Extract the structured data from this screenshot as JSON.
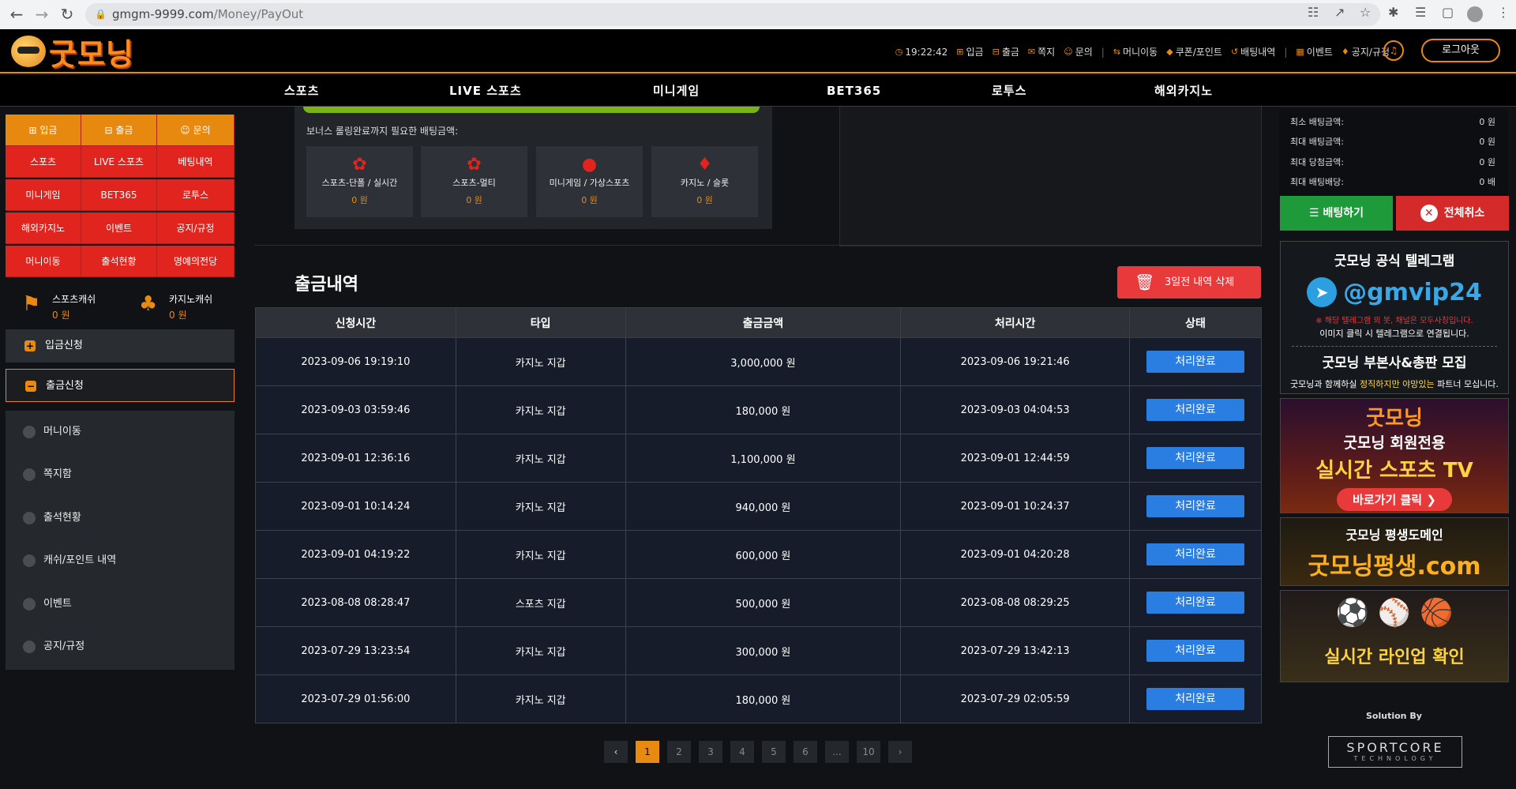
{
  "browser": {
    "url_host": "gmgm-9999.com",
    "url_path": "/Money/PayOut"
  },
  "header": {
    "logo_text": "굿모닝",
    "time": "19:22:42",
    "menu": [
      "입금",
      "출금",
      "쪽지",
      "문의",
      "머니이동",
      "쿠폰/포인트",
      "배팅내역",
      "이벤트",
      "공지/규정"
    ],
    "logout_label": "로그아웃"
  },
  "mainnav": [
    "스포츠",
    "LIVE 스포츠",
    "미니게임",
    "BET365",
    "로투스",
    "해외카지노"
  ],
  "sidebar": {
    "quick_top": [
      "입금",
      "출금",
      "문의"
    ],
    "quick_grid": [
      "스포츠",
      "LIVE 스포츠",
      "베팅내역",
      "미니게임",
      "BET365",
      "로투스",
      "해외카지노",
      "이벤트",
      "공지/규정",
      "머니이동",
      "출석현황",
      "명예의전당"
    ],
    "sports_cash_label": "스포츠캐쉬",
    "sports_cash_value": "0 원",
    "casino_cash_label": "카지노캐쉬",
    "casino_cash_value": "0 원",
    "deposit_request": "입금신청",
    "withdraw_request": "출금신청",
    "sub_items": [
      "머니이동",
      "쪽지함",
      "출석현황",
      "캐쉬/포인트 내역",
      "이벤트",
      "공지/규정"
    ]
  },
  "bonus": {
    "title": "보너스 롤링완료까지 필요한 배팅금액:",
    "cards": [
      {
        "label": "스포츠-단폴 / 실시간",
        "value": "0 원"
      },
      {
        "label": "스포츠-멀티",
        "value": "0 원"
      },
      {
        "label": "미니게임 / 가상스포츠",
        "value": "0 원"
      },
      {
        "label": "카지노 / 슬롯",
        "value": "0 원"
      }
    ]
  },
  "withdraw": {
    "title": "출금내역",
    "delete_label": "3일전 내역 삭제",
    "columns": [
      "신청시간",
      "타입",
      "출금금액",
      "처리시간",
      "상태"
    ],
    "rows": [
      [
        "2023-09-06 19:19:10",
        "카지노 지갑",
        "3,000,000 원",
        "2023-09-06 19:21:46",
        "처리완료"
      ],
      [
        "2023-09-03 03:59:46",
        "카지노 지갑",
        "180,000 원",
        "2023-09-03 04:04:53",
        "처리완료"
      ],
      [
        "2023-09-01 12:36:16",
        "카지노 지갑",
        "1,100,000 원",
        "2023-09-01 12:44:59",
        "처리완료"
      ],
      [
        "2023-09-01 10:14:24",
        "카지노 지갑",
        "940,000 원",
        "2023-09-01 10:24:37",
        "처리완료"
      ],
      [
        "2023-09-01 04:19:22",
        "카지노 지갑",
        "600,000 원",
        "2023-09-01 04:20:28",
        "처리완료"
      ],
      [
        "2023-08-08 08:28:47",
        "스포츠 지갑",
        "500,000 원",
        "2023-08-08 08:29:25",
        "처리완료"
      ],
      [
        "2023-07-29 13:23:54",
        "카지노 지갑",
        "300,000 원",
        "2023-07-29 13:42:13",
        "처리완료"
      ],
      [
        "2023-07-29 01:56:00",
        "카지노 지갑",
        "180,000 원",
        "2023-07-29 02:05:59",
        "처리완료"
      ]
    ],
    "pages": [
      "1",
      "2",
      "3",
      "4",
      "5",
      "6",
      "...",
      "10"
    ],
    "current_page": "1"
  },
  "betslip": {
    "rows": [
      {
        "label": "최소 배팅금액:",
        "value": "0 원"
      },
      {
        "label": "최대 배팅금액:",
        "value": "0 원"
      },
      {
        "label": "최대 당첨금액:",
        "value": "0 원"
      },
      {
        "label": "최대 배팅배당:",
        "value": "0 배"
      }
    ],
    "bet_label": "배팅하기",
    "cancel_label": "전체취소"
  },
  "banners": {
    "telegram_title": "굿모닝 공식 텔레그램",
    "telegram_id": "@gmvip24",
    "telegram_note1": "※ 해당 텔레그램 외 봇, 채널은 모두사칭입니다.",
    "telegram_note2": "이미지 클릭 시 텔레그램으로 연결됩니다.",
    "partner_title": "굿모닝 부본사&총판 모집",
    "partner_note_a": "굿모닝과 함께하실 ",
    "partner_note_b": "정직하지만 야망있는",
    "partner_note_c": " 파트너 모십니다.",
    "tv_logo": "굿모닝",
    "tv_line1": "굿모닝 회원전용",
    "tv_line2": "실시간 스포츠 TV",
    "tv_go": "바로가기 클릭",
    "domain_line1": "굿모닝 평생도메인",
    "domain_line2": "굿모닝평생.com",
    "lineup": "실시간 라인업 확인"
  },
  "footer": {
    "solution_by": "Solution By",
    "brand": "SPORTCORE",
    "brand_sub": "TECHNOLOGY"
  },
  "colors": {
    "accent": "#e88a12",
    "red": "#e1241d",
    "status_blue": "#2a7de1",
    "green": "#1f9a3a"
  }
}
